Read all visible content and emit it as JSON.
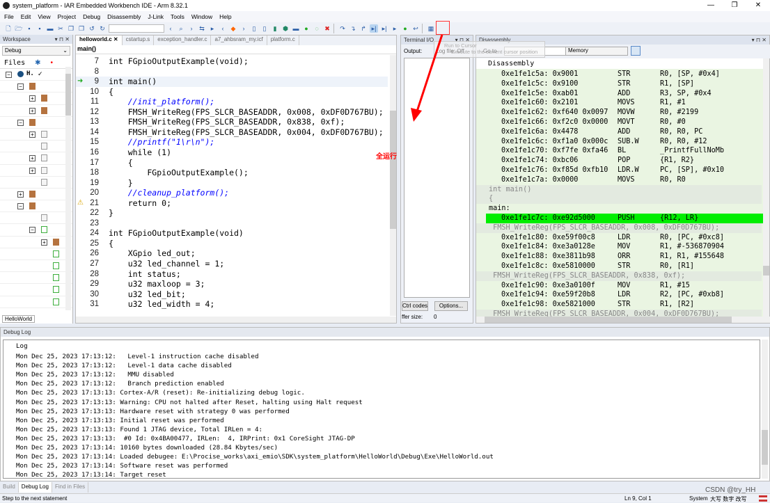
{
  "window": {
    "title": "system_platform - IAR Embedded Workbench IDE - Arm 8.32.1",
    "min": "—",
    "max": "❐",
    "close": "✕"
  },
  "menu": [
    "File",
    "Edit",
    "View",
    "Project",
    "Debug",
    "Disassembly",
    "J-Link",
    "Tools",
    "Window",
    "Help"
  ],
  "tooltip": {
    "title": "Run to Cursor",
    "desc": "Execute to the current cursor position"
  },
  "annotation": {
    "text": "全运行",
    "color": "#ff0000"
  },
  "workspace": {
    "title": "Workspace",
    "config": "Debug",
    "files_label": "Files",
    "root": "H.",
    "tab": "HelloWorld"
  },
  "editor": {
    "tabs": [
      "helloworld.c",
      "cstartup.s",
      "exception_handler.c",
      "a7_ahbsram_my.icf",
      "platform.c"
    ],
    "function": "main()",
    "lines": [
      {
        "n": "7",
        "t": "int FGpioOutputExample(void);"
      },
      {
        "n": "8",
        "t": ""
      },
      {
        "n": "9",
        "t": "int main()"
      },
      {
        "n": "10",
        "t": "{"
      },
      {
        "n": "11",
        "t": "    //init_platform();"
      },
      {
        "n": "12",
        "t": "    FMSH_WriteReg(FPS_SLCR_BASEADDR, 0x008, 0xDF0D767BU);"
      },
      {
        "n": "13",
        "t": "    FMSH_WriteReg(FPS_SLCR_BASEADDR, 0x838, 0xf);"
      },
      {
        "n": "14",
        "t": "    FMSH_WriteReg(FPS_SLCR_BASEADDR, 0x004, 0xDF0D767BU);"
      },
      {
        "n": "15",
        "t": "    //printf(\"1\\r\\n\");"
      },
      {
        "n": "16",
        "t": "    while (1)"
      },
      {
        "n": "17",
        "t": "    {"
      },
      {
        "n": "18",
        "t": "        FGpioOutputExample();"
      },
      {
        "n": "19",
        "t": "    }"
      },
      {
        "n": "20",
        "t": "    //cleanup_platform();"
      },
      {
        "n": "21",
        "t": "    return 0;"
      },
      {
        "n": "22",
        "t": "}"
      },
      {
        "n": "23",
        "t": ""
      },
      {
        "n": "24",
        "t": "int FGpioOutputExample(void)"
      },
      {
        "n": "25",
        "t": "{"
      },
      {
        "n": "26",
        "t": "    XGpio led_out;"
      },
      {
        "n": "27",
        "t": "    u32 led_channel = 1;"
      },
      {
        "n": "28",
        "t": "    int status;"
      },
      {
        "n": "29",
        "t": "    u32 maxloop = 3;"
      },
      {
        "n": "30",
        "t": "    u32 led_bit;"
      },
      {
        "n": "31",
        "t": "    u32 led_width = 4;"
      }
    ]
  },
  "terminal": {
    "title": "Terminal I/O",
    "output_label": "Output:",
    "log_file": "Log file: Off",
    "ctrl_codes": "Ctrl codes",
    "options": "Options...",
    "buffer_label": "ffer size:",
    "buffer_value": "0"
  },
  "disassembly": {
    "title": "Disassembly",
    "goto_label": "Go to",
    "memory": "Memory",
    "header": "Disassembly",
    "rows": [
      {
        "a": "0xe1fe1c5a: 0x9001",
        "m": "STR",
        "o": "R0, [SP, #0x4]"
      },
      {
        "a": "0xe1fe1c5c: 0x9100",
        "m": "STR",
        "o": "R1, [SP]"
      },
      {
        "a": "0xe1fe1c5e: 0xab01",
        "m": "ADD",
        "o": "R3, SP, #0x4"
      },
      {
        "a": "0xe1fe1c60: 0x2101",
        "m": "MOVS",
        "o": "R1, #1"
      },
      {
        "a": "0xe1fe1c62: 0xf640 0x0097",
        "m": "MOVW",
        "o": "R0, #2199"
      },
      {
        "a": "0xe1fe1c66: 0xf2c0 0x0000",
        "m": "MOVT",
        "o": "R0, #0"
      },
      {
        "a": "0xe1fe1c6a: 0x4478",
        "m": "ADD",
        "o": "R0, R0, PC"
      },
      {
        "a": "0xe1fe1c6c: 0xf1a0 0x000c",
        "m": "SUB.W",
        "o": "R0, R0, #12"
      },
      {
        "a": "0xe1fe1c70: 0xf7fe 0xfa46",
        "m": "BL",
        "o": "_PrintfFullNoMb"
      },
      {
        "a": "0xe1fe1c74: 0xbc06",
        "m": "POP",
        "o": "{R1, R2}"
      },
      {
        "a": "0xe1fe1c76: 0xf85d 0xfb10",
        "m": "LDR.W",
        "o": "PC, [SP], #0x10"
      },
      {
        "a": "0xe1fe1c7a: 0x0000",
        "m": "MOVS",
        "o": "R0, R0"
      },
      {
        "src": "int main()"
      },
      {
        "src": "{"
      },
      {
        "label": "main:"
      },
      {
        "a": "0xe1fe1c7c: 0xe92d5000",
        "m": "PUSH",
        "o": "{R12, LR}",
        "pc": true
      },
      {
        "src": " FMSH_WriteReg(FPS_SLCR_BASEADDR, 0x008, 0xDF0D767BU);"
      },
      {
        "a": "0xe1fe1c80: 0xe59f00c8",
        "m": "LDR",
        "o": "R0, [PC, #0xc8]"
      },
      {
        "a": "0xe1fe1c84: 0xe3a0128e",
        "m": "MOV",
        "o": "R1, #-536870904"
      },
      {
        "a": "0xe1fe1c88: 0xe3811b98",
        "m": "ORR",
        "o": "R1, R1, #155648"
      },
      {
        "a": "0xe1fe1c8c: 0xe5810000",
        "m": "STR",
        "o": "R0, [R1]"
      },
      {
        "src": " FMSH_WriteReg(FPS_SLCR_BASEADDR, 0x838, 0xf);"
      },
      {
        "a": "0xe1fe1c90: 0xe3a0100f",
        "m": "MOV",
        "o": "R1, #15"
      },
      {
        "a": "0xe1fe1c94: 0xe59f20b8",
        "m": "LDR",
        "o": "R2, [PC, #0xb8]"
      },
      {
        "a": "0xe1fe1c98: 0xe5821000",
        "m": "STR",
        "o": "R1, [R2]"
      },
      {
        "src": " FMSH_WriteReg(FPS_SLCR_BASEADDR, 0x004, 0xDF0D767BU);"
      }
    ]
  },
  "debuglog": {
    "title": "Debug Log",
    "header": "Log",
    "lines": [
      "Mon Dec 25, 2023 17:13:12:   Level-1 instruction cache disabled",
      "Mon Dec 25, 2023 17:13:12:   Level-1 data cache disabled",
      "Mon Dec 25, 2023 17:13:12:   MMU disabled",
      "Mon Dec 25, 2023 17:13:12:   Branch prediction enabled",
      "Mon Dec 25, 2023 17:13:13: Cortex-A/R (reset): Re-initializing debug logic.",
      "Mon Dec 25, 2023 17:13:13: Warning: CPU not halted after Reset, halting using Halt request",
      "Mon Dec 25, 2023 17:13:13: Hardware reset with strategy 0 was performed",
      "Mon Dec 25, 2023 17:13:13: Initial reset was performed",
      "Mon Dec 25, 2023 17:13:13: Found 1 JTAG device, Total IRLen = 4:",
      "Mon Dec 25, 2023 17:13:13:  #0 Id: 0x4BA00477, IRLen:  4, IRPrint: 0x1 CoreSight JTAG-DP",
      "Mon Dec 25, 2023 17:13:14: 10160 bytes downloaded (28.84 Kbytes/sec)",
      "Mon Dec 25, 2023 17:13:14: Loaded debugee: E:\\Procise_works\\axi_emio\\SDK\\system_platform\\HelloWorld\\Debug\\Exe\\HelloWorld.out",
      "Mon Dec 25, 2023 17:13:14: Software reset was performed",
      "Mon Dec 25, 2023 17:13:14: Target reset"
    ]
  },
  "bottom_tabs": [
    "Build",
    "Debug Log",
    "Find in Files"
  ],
  "status": {
    "message": "Step to the next statement",
    "position": "Ln 9, Col 1",
    "system": "System",
    "ime": "大写 数字 改写",
    "watermark": "CSDN @try_HH"
  }
}
